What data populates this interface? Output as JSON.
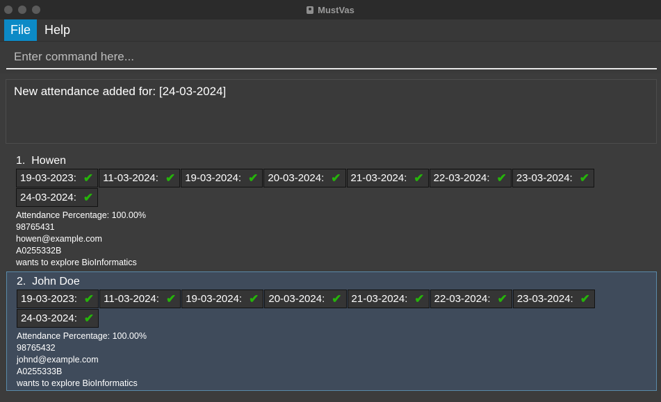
{
  "window": {
    "title": "MustVas"
  },
  "menu": {
    "file": "File",
    "help": "Help"
  },
  "command": {
    "placeholder": "Enter command here..."
  },
  "result": {
    "message": "New attendance added for: [24-03-2024]"
  },
  "persons": [
    {
      "index": "1.",
      "name": "Howen",
      "attendance": [
        "19-03-2023:",
        "11-03-2024:",
        "19-03-2024:",
        "20-03-2024:",
        "21-03-2024:",
        "22-03-2024:",
        "23-03-2024:",
        "24-03-2024:"
      ],
      "percentage": "Attendance Percentage: 100.00%",
      "phone": "98765431",
      "email": "howen@example.com",
      "matric": "A0255332B",
      "description": "wants to explore BioInformatics"
    },
    {
      "index": "2.",
      "name": "John Doe",
      "attendance": [
        "19-03-2023:",
        "11-03-2024:",
        "19-03-2024:",
        "20-03-2024:",
        "21-03-2024:",
        "22-03-2024:",
        "23-03-2024:",
        "24-03-2024:"
      ],
      "percentage": "Attendance Percentage: 100.00%",
      "phone": "98765432",
      "email": "johnd@example.com",
      "matric": "A0255333B",
      "description": "wants to explore BioInformatics"
    }
  ],
  "icons": {
    "check": "check-icon",
    "app": "app-icon"
  },
  "colors": {
    "selected_menu": "#0c8ac6",
    "check": "#26b30b",
    "selected_card": "#3f4b5b"
  }
}
